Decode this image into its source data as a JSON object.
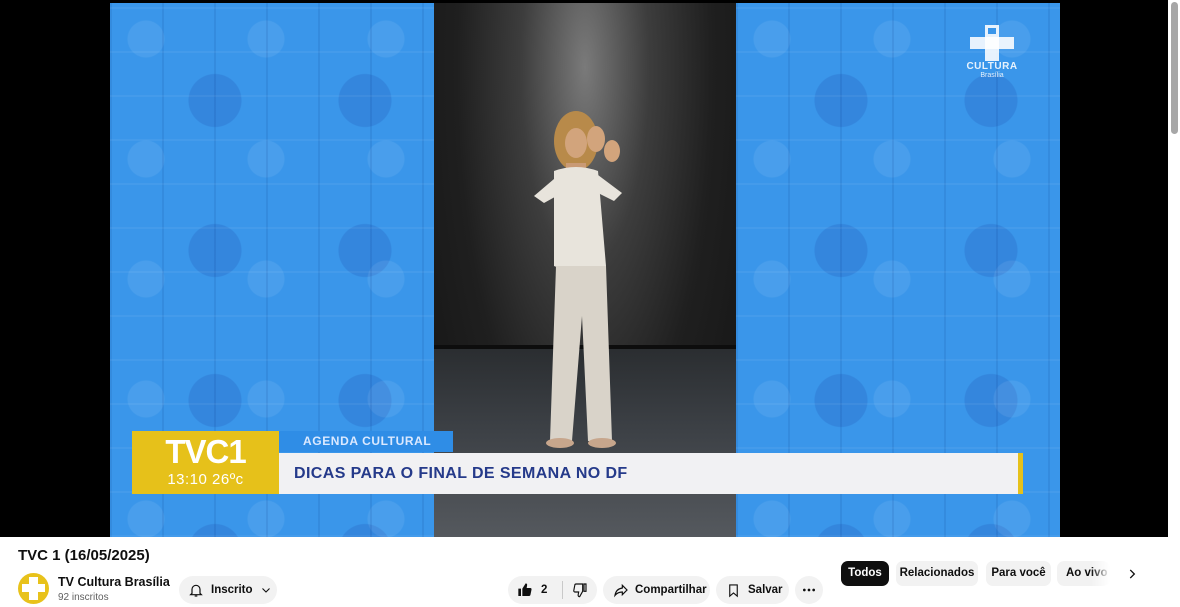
{
  "video": {
    "title": "TVC 1 (16/05/2025)"
  },
  "overlay": {
    "program": "TVC1",
    "time_temp": "13:10 26ºc",
    "segment": "AGENDA CULTURAL",
    "headline": "DICAS PARA O FINAL DE SEMANA NO DF",
    "channel_logo_text": "CULTURA",
    "channel_logo_sub": "Brasília",
    "colors": {
      "yellow": "#e6c11a",
      "blue": "#2f8de6",
      "headline_text": "#253a8a"
    }
  },
  "channel": {
    "name": "TV Cultura Brasília",
    "subscribers": "92 inscritos",
    "subscribe_label": "Inscrito"
  },
  "actions": {
    "like_count": "2",
    "share_label": "Compartilhar",
    "save_label": "Salvar"
  },
  "chips": [
    {
      "label": "Todos",
      "selected": true
    },
    {
      "label": "Relacionados",
      "selected": false
    },
    {
      "label": "Para você",
      "selected": false
    },
    {
      "label": "Ao vivo",
      "selected": false
    }
  ],
  "icons": {
    "bell": "bell-icon",
    "chevron_down": "chevron-down-icon",
    "like": "thumbs-up-icon",
    "dislike": "thumbs-down-icon",
    "share": "share-arrow-icon",
    "save": "bookmark-icon",
    "more": "more-horizontal-icon",
    "next": "chevron-right-icon"
  }
}
